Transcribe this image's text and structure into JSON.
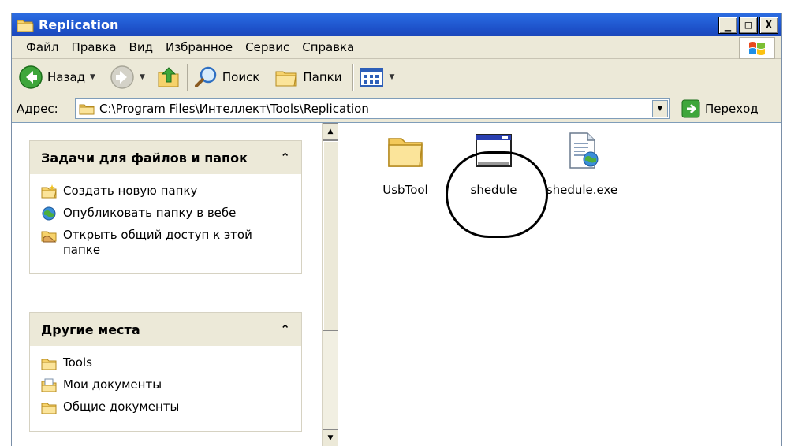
{
  "window": {
    "title": "Replication",
    "buttons": [
      "_",
      "□",
      "X"
    ]
  },
  "menubar": {
    "items": [
      "Файл",
      "Правка",
      "Вид",
      "Избранное",
      "Сервис",
      "Справка"
    ]
  },
  "toolbar": {
    "back_label": "Назад",
    "search_label": "Поиск",
    "folders_label": "Папки"
  },
  "address": {
    "label": "Адрес:",
    "value": "C:\\Program Files\\Интеллект\\Tools\\Replication",
    "go_label": "Переход"
  },
  "left_pane": {
    "tasks_panel": {
      "title": "Задачи для файлов и папок",
      "items": [
        {
          "label": "Создать новую папку",
          "icon": "new-folder-icon"
        },
        {
          "label": "Опубликовать папку в вебе",
          "icon": "publish-web-icon"
        },
        {
          "label": "Открыть общий доступ к этой папке",
          "icon": "share-folder-icon"
        }
      ]
    },
    "places_panel": {
      "title": "Другие места",
      "items": [
        {
          "label": "Tools",
          "icon": "folder-icon"
        },
        {
          "label": "Мои документы",
          "icon": "my-documents-icon"
        },
        {
          "label": "Общие документы",
          "icon": "shared-documents-icon"
        }
      ]
    }
  },
  "files": [
    {
      "name": "UsbTool",
      "type": "folder"
    },
    {
      "name": "shedule",
      "type": "application",
      "highlighted": true
    },
    {
      "name": "shedule.exe",
      "type": "exe-document"
    }
  ],
  "colors": {
    "titlebar": "#2461d8",
    "panel_header": "#ece9d8",
    "highlight_ring": "#000000"
  }
}
